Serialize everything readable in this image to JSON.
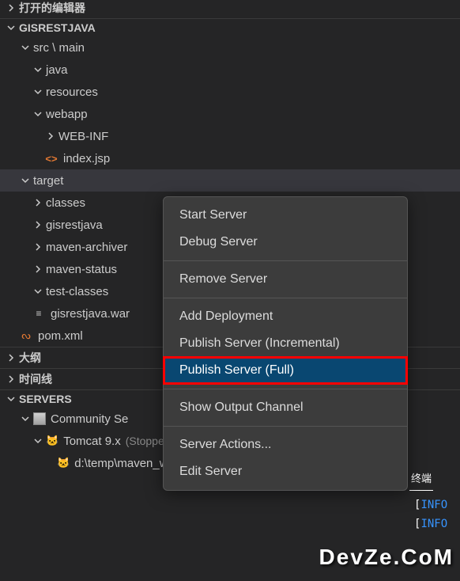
{
  "sections": {
    "openEditors": "打开的编辑器",
    "project": "GISRESTJAVA",
    "outline": "大纲",
    "timeline": "时间线",
    "servers": "SERVERS"
  },
  "tree": {
    "srcMain": "src \\ main",
    "java": "java",
    "resources": "resources",
    "webapp": "webapp",
    "webInf": "WEB-INF",
    "indexJsp": "index.jsp",
    "target": "target",
    "classes": "classes",
    "gisrestjava": "gisrestjava",
    "mavenArchiver": "maven-archiver",
    "mavenStatus": "maven-status",
    "testClasses": "test-classes",
    "gisrestjavaWar": "gisrestjava.war",
    "pomXml": "pom.xml"
  },
  "servers": {
    "community": "Community Se",
    "tomcat": "Tomcat 9.x",
    "tomcatStatus": "(Stopped) (Full Publish Required)",
    "deployPath": "d:\\temp\\maven_webapp\\gisrestjava\\t"
  },
  "menu": {
    "startServer": "Start Server",
    "debugServer": "Debug Server",
    "removeServer": "Remove Server",
    "addDeployment": "Add Deployment",
    "publishIncremental": "Publish Server (Incremental)",
    "publishFull": "Publish Server (Full)",
    "showOutput": "Show Output Channel",
    "serverActions": "Server Actions...",
    "editServer": "Edit Server"
  },
  "terminal": {
    "tab": "终端",
    "logPrefix": "[",
    "logLevel": "INFO"
  },
  "watermark": "DevZe.CoM"
}
